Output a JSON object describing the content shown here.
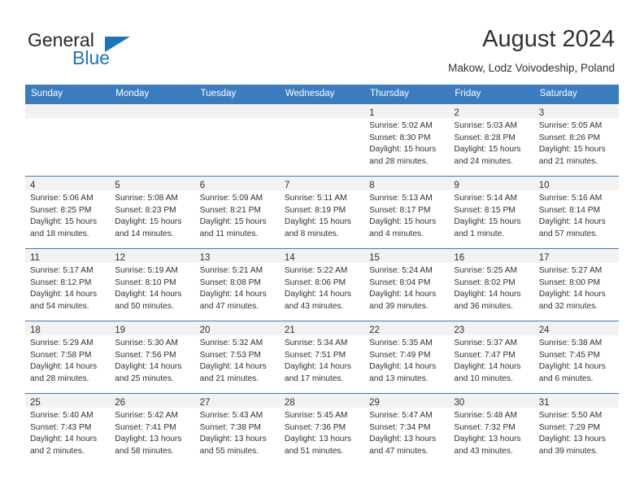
{
  "logo": {
    "word_primary": "General",
    "word_secondary": "Blue",
    "primary_color": "#282828",
    "accent_color": "#1b75bb"
  },
  "header": {
    "title": "August 2024",
    "location": "Makow, Lodz Voivodeship, Poland"
  },
  "calendar": {
    "header_background": "#3b7cbe",
    "daynum_band_color": "#f2f2f2",
    "weekdays": [
      "Sunday",
      "Monday",
      "Tuesday",
      "Wednesday",
      "Thursday",
      "Friday",
      "Saturday"
    ],
    "weeks": [
      [
        {
          "day": "",
          "lines": []
        },
        {
          "day": "",
          "lines": []
        },
        {
          "day": "",
          "lines": []
        },
        {
          "day": "",
          "lines": []
        },
        {
          "day": "1",
          "lines": [
            "Sunrise: 5:02 AM",
            "Sunset: 8:30 PM",
            "Daylight: 15 hours",
            "and 28 minutes."
          ]
        },
        {
          "day": "2",
          "lines": [
            "Sunrise: 5:03 AM",
            "Sunset: 8:28 PM",
            "Daylight: 15 hours",
            "and 24 minutes."
          ]
        },
        {
          "day": "3",
          "lines": [
            "Sunrise: 5:05 AM",
            "Sunset: 8:26 PM",
            "Daylight: 15 hours",
            "and 21 minutes."
          ]
        }
      ],
      [
        {
          "day": "4",
          "lines": [
            "Sunrise: 5:06 AM",
            "Sunset: 8:25 PM",
            "Daylight: 15 hours",
            "and 18 minutes."
          ]
        },
        {
          "day": "5",
          "lines": [
            "Sunrise: 5:08 AM",
            "Sunset: 8:23 PM",
            "Daylight: 15 hours",
            "and 14 minutes."
          ]
        },
        {
          "day": "6",
          "lines": [
            "Sunrise: 5:09 AM",
            "Sunset: 8:21 PM",
            "Daylight: 15 hours",
            "and 11 minutes."
          ]
        },
        {
          "day": "7",
          "lines": [
            "Sunrise: 5:11 AM",
            "Sunset: 8:19 PM",
            "Daylight: 15 hours",
            "and 8 minutes."
          ]
        },
        {
          "day": "8",
          "lines": [
            "Sunrise: 5:13 AM",
            "Sunset: 8:17 PM",
            "Daylight: 15 hours",
            "and 4 minutes."
          ]
        },
        {
          "day": "9",
          "lines": [
            "Sunrise: 5:14 AM",
            "Sunset: 8:15 PM",
            "Daylight: 15 hours",
            "and 1 minute."
          ]
        },
        {
          "day": "10",
          "lines": [
            "Sunrise: 5:16 AM",
            "Sunset: 8:14 PM",
            "Daylight: 14 hours",
            "and 57 minutes."
          ]
        }
      ],
      [
        {
          "day": "11",
          "lines": [
            "Sunrise: 5:17 AM",
            "Sunset: 8:12 PM",
            "Daylight: 14 hours",
            "and 54 minutes."
          ]
        },
        {
          "day": "12",
          "lines": [
            "Sunrise: 5:19 AM",
            "Sunset: 8:10 PM",
            "Daylight: 14 hours",
            "and 50 minutes."
          ]
        },
        {
          "day": "13",
          "lines": [
            "Sunrise: 5:21 AM",
            "Sunset: 8:08 PM",
            "Daylight: 14 hours",
            "and 47 minutes."
          ]
        },
        {
          "day": "14",
          "lines": [
            "Sunrise: 5:22 AM",
            "Sunset: 8:06 PM",
            "Daylight: 14 hours",
            "and 43 minutes."
          ]
        },
        {
          "day": "15",
          "lines": [
            "Sunrise: 5:24 AM",
            "Sunset: 8:04 PM",
            "Daylight: 14 hours",
            "and 39 minutes."
          ]
        },
        {
          "day": "16",
          "lines": [
            "Sunrise: 5:25 AM",
            "Sunset: 8:02 PM",
            "Daylight: 14 hours",
            "and 36 minutes."
          ]
        },
        {
          "day": "17",
          "lines": [
            "Sunrise: 5:27 AM",
            "Sunset: 8:00 PM",
            "Daylight: 14 hours",
            "and 32 minutes."
          ]
        }
      ],
      [
        {
          "day": "18",
          "lines": [
            "Sunrise: 5:29 AM",
            "Sunset: 7:58 PM",
            "Daylight: 14 hours",
            "and 28 minutes."
          ]
        },
        {
          "day": "19",
          "lines": [
            "Sunrise: 5:30 AM",
            "Sunset: 7:56 PM",
            "Daylight: 14 hours",
            "and 25 minutes."
          ]
        },
        {
          "day": "20",
          "lines": [
            "Sunrise: 5:32 AM",
            "Sunset: 7:53 PM",
            "Daylight: 14 hours",
            "and 21 minutes."
          ]
        },
        {
          "day": "21",
          "lines": [
            "Sunrise: 5:34 AM",
            "Sunset: 7:51 PM",
            "Daylight: 14 hours",
            "and 17 minutes."
          ]
        },
        {
          "day": "22",
          "lines": [
            "Sunrise: 5:35 AM",
            "Sunset: 7:49 PM",
            "Daylight: 14 hours",
            "and 13 minutes."
          ]
        },
        {
          "day": "23",
          "lines": [
            "Sunrise: 5:37 AM",
            "Sunset: 7:47 PM",
            "Daylight: 14 hours",
            "and 10 minutes."
          ]
        },
        {
          "day": "24",
          "lines": [
            "Sunrise: 5:38 AM",
            "Sunset: 7:45 PM",
            "Daylight: 14 hours",
            "and 6 minutes."
          ]
        }
      ],
      [
        {
          "day": "25",
          "lines": [
            "Sunrise: 5:40 AM",
            "Sunset: 7:43 PM",
            "Daylight: 14 hours",
            "and 2 minutes."
          ]
        },
        {
          "day": "26",
          "lines": [
            "Sunrise: 5:42 AM",
            "Sunset: 7:41 PM",
            "Daylight: 13 hours",
            "and 58 minutes."
          ]
        },
        {
          "day": "27",
          "lines": [
            "Sunrise: 5:43 AM",
            "Sunset: 7:38 PM",
            "Daylight: 13 hours",
            "and 55 minutes."
          ]
        },
        {
          "day": "28",
          "lines": [
            "Sunrise: 5:45 AM",
            "Sunset: 7:36 PM",
            "Daylight: 13 hours",
            "and 51 minutes."
          ]
        },
        {
          "day": "29",
          "lines": [
            "Sunrise: 5:47 AM",
            "Sunset: 7:34 PM",
            "Daylight: 13 hours",
            "and 47 minutes."
          ]
        },
        {
          "day": "30",
          "lines": [
            "Sunrise: 5:48 AM",
            "Sunset: 7:32 PM",
            "Daylight: 13 hours",
            "and 43 minutes."
          ]
        },
        {
          "day": "31",
          "lines": [
            "Sunrise: 5:50 AM",
            "Sunset: 7:29 PM",
            "Daylight: 13 hours",
            "and 39 minutes."
          ]
        }
      ]
    ]
  }
}
